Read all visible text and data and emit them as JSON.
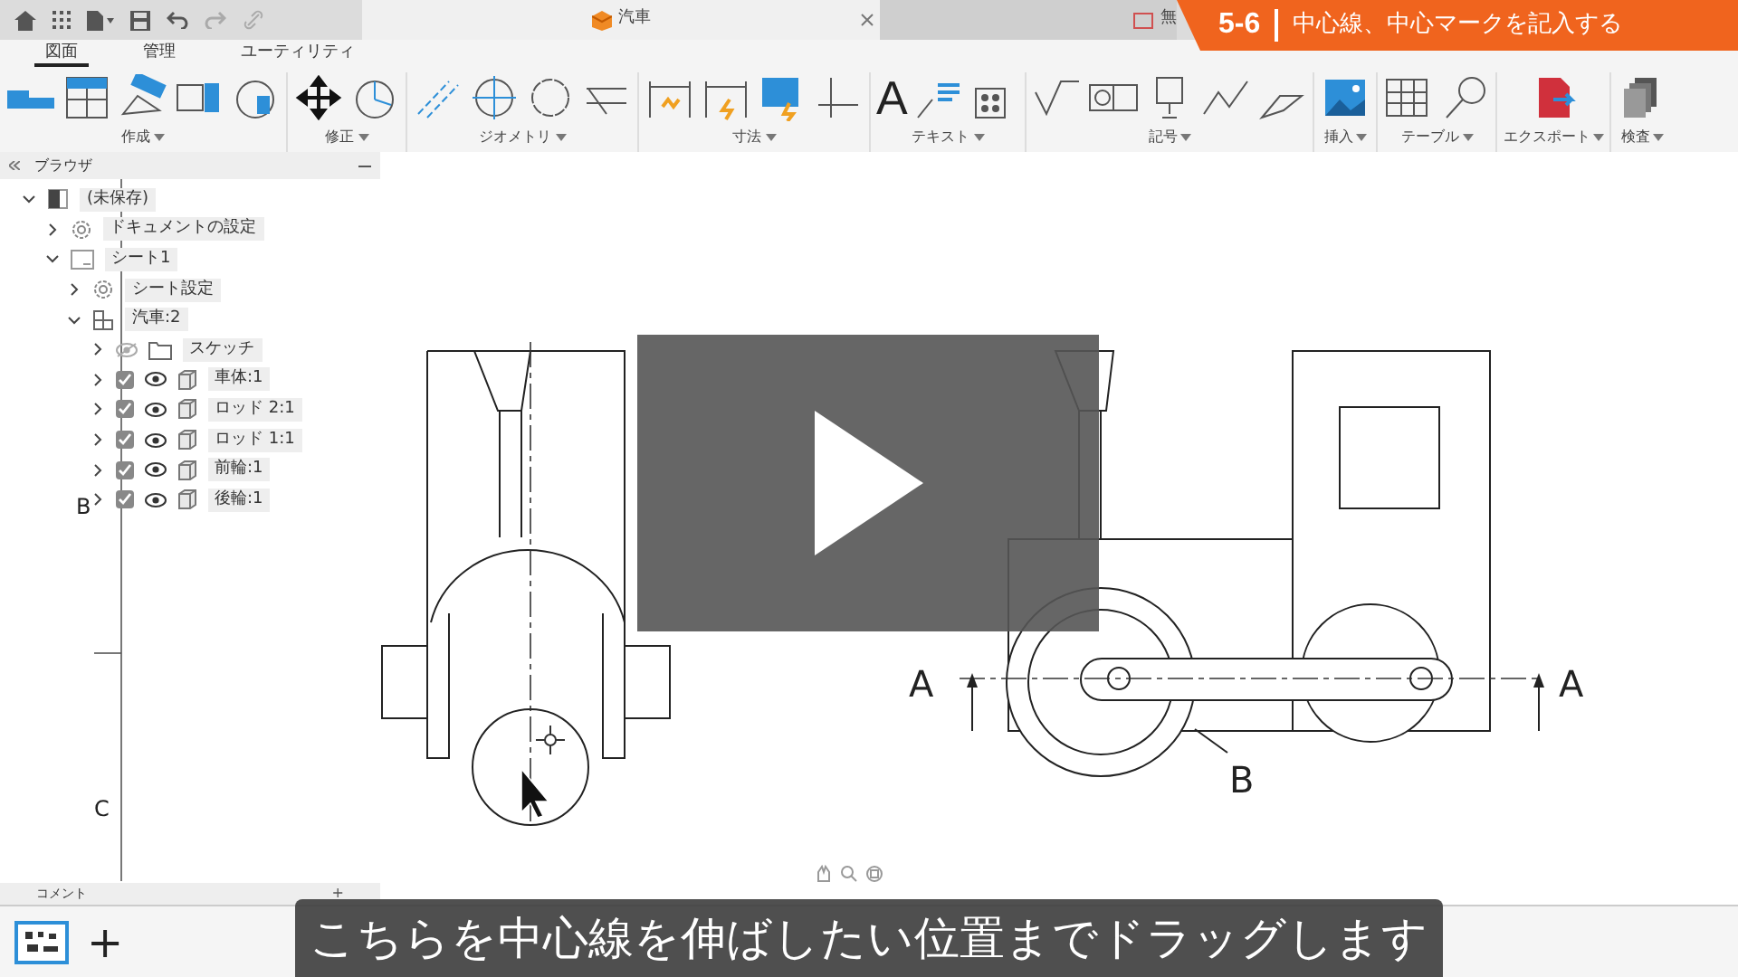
{
  "title_bar": {
    "tabs": [
      {
        "label": "汽車",
        "selected": true
      },
      {
        "label": "無",
        "selected": false
      }
    ]
  },
  "banner": {
    "chapter": "5-6",
    "title": "中心線、中心マークを記入する"
  },
  "ribbon": {
    "tabs": [
      {
        "label": "図面",
        "selected": true
      },
      {
        "label": "管理",
        "selected": false
      },
      {
        "label": "ユーティリティ",
        "selected": false
      }
    ],
    "groups": [
      {
        "label": "作成"
      },
      {
        "label": "修正"
      },
      {
        "label": "ジオメトリ"
      },
      {
        "label": "寸法"
      },
      {
        "label": "テキスト",
        "glyph": "A"
      },
      {
        "label": "記号"
      },
      {
        "label": "挿入"
      },
      {
        "label": "テーブル"
      },
      {
        "label": "エクスポート"
      },
      {
        "label": "検査"
      }
    ]
  },
  "browser": {
    "title": "ブラウザ",
    "tree": [
      {
        "label": "(未保存)",
        "kind": "document",
        "expanded": true,
        "children": [
          {
            "label": "ドキュメントの設定",
            "kind": "settings",
            "expanded": false
          },
          {
            "label": "シート1",
            "kind": "sheet",
            "expanded": true,
            "children": [
              {
                "label": "シート設定",
                "kind": "settings",
                "expanded": false
              },
              {
                "label": "汽車:2",
                "kind": "component",
                "expanded": true,
                "children": [
                  {
                    "label": "スケッチ",
                    "kind": "folder",
                    "expanded": false,
                    "visible": false
                  },
                  {
                    "label": "車体:1",
                    "kind": "body",
                    "expanded": false,
                    "visible": true,
                    "checked": true
                  },
                  {
                    "label": "ロッド 2:1",
                    "kind": "body",
                    "expanded": false,
                    "visible": true,
                    "checked": true
                  },
                  {
                    "label": "ロッド 1:1",
                    "kind": "body",
                    "expanded": false,
                    "visible": true,
                    "checked": true
                  },
                  {
                    "label": "前輪:1",
                    "kind": "body",
                    "expanded": false,
                    "visible": true,
                    "checked": true
                  },
                  {
                    "label": "後輪:1",
                    "kind": "body",
                    "expanded": false,
                    "visible": true,
                    "checked": true
                  }
                ]
              }
            ]
          }
        ]
      }
    ]
  },
  "drawing": {
    "zone_labels": [
      "B",
      "C"
    ],
    "section_labels": [
      "A",
      "A"
    ],
    "detail_label": "B"
  },
  "comments": {
    "title": "コメント",
    "add": "+"
  },
  "sheets": {
    "add": "+"
  },
  "subtitle": "こちらを中心線を伸ばしたい位置までドラッグします"
}
